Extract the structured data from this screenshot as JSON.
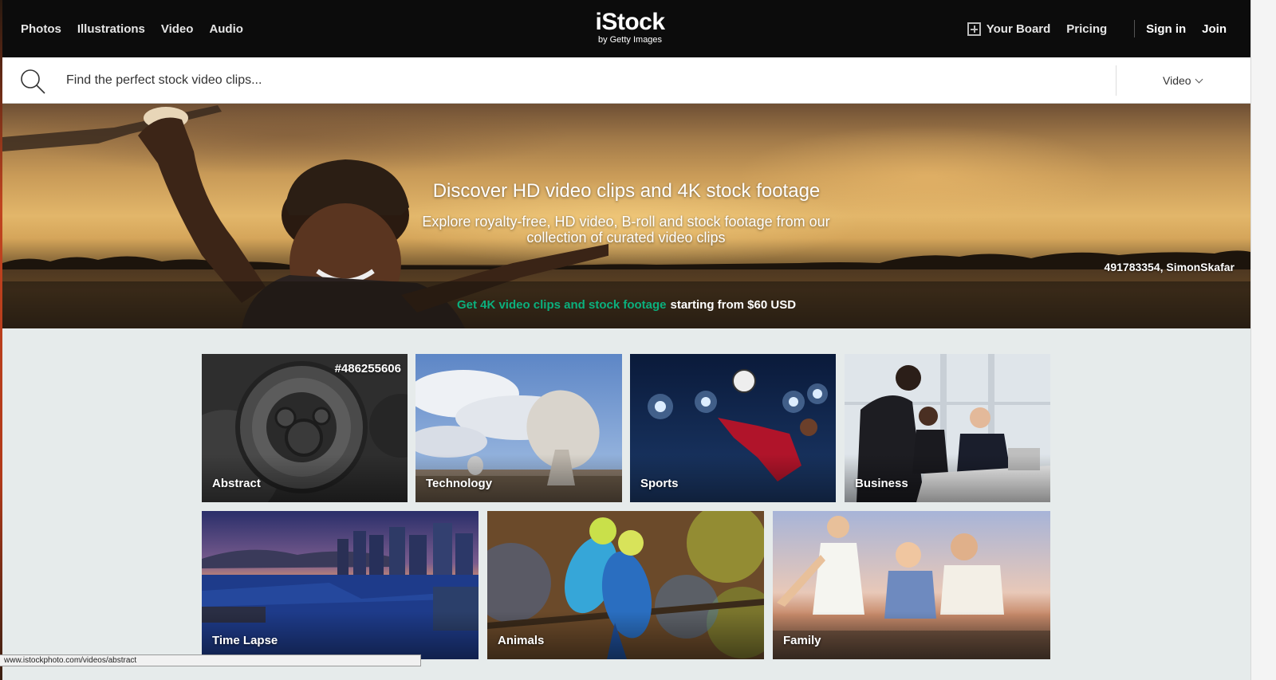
{
  "nav": {
    "links": [
      "Photos",
      "Illustrations",
      "Video",
      "Audio"
    ],
    "logo_main": "iStock",
    "logo_sub": "by Getty Images",
    "your_board": "Your Board",
    "pricing": "Pricing",
    "sign_in": "Sign in",
    "join": "Join"
  },
  "search": {
    "placeholder": "Find the perfect stock video clips...",
    "type": "Video"
  },
  "hero": {
    "title": "Discover HD video clips and 4K stock footage",
    "subtitle": "Explore royalty-free, HD video, B-roll and stock footage from our collection of curated video clips",
    "credit": "491783354, SimonSkafar",
    "banner_link": "Get 4K video clips and stock footage",
    "banner_text": "starting from $60 USD"
  },
  "categories": [
    {
      "label": "Abstract",
      "id": "#486255606"
    },
    {
      "label": "Technology"
    },
    {
      "label": "Sports"
    },
    {
      "label": "Business"
    },
    {
      "label": "Time Lapse"
    },
    {
      "label": "Animals"
    },
    {
      "label": "Family"
    }
  ],
  "status_url": "www.istockphoto.com/videos/abstract",
  "colors": {
    "topbar": "#0c0c0c",
    "accent_green": "#0bb07d",
    "page_bg": "#e6ebeb"
  }
}
